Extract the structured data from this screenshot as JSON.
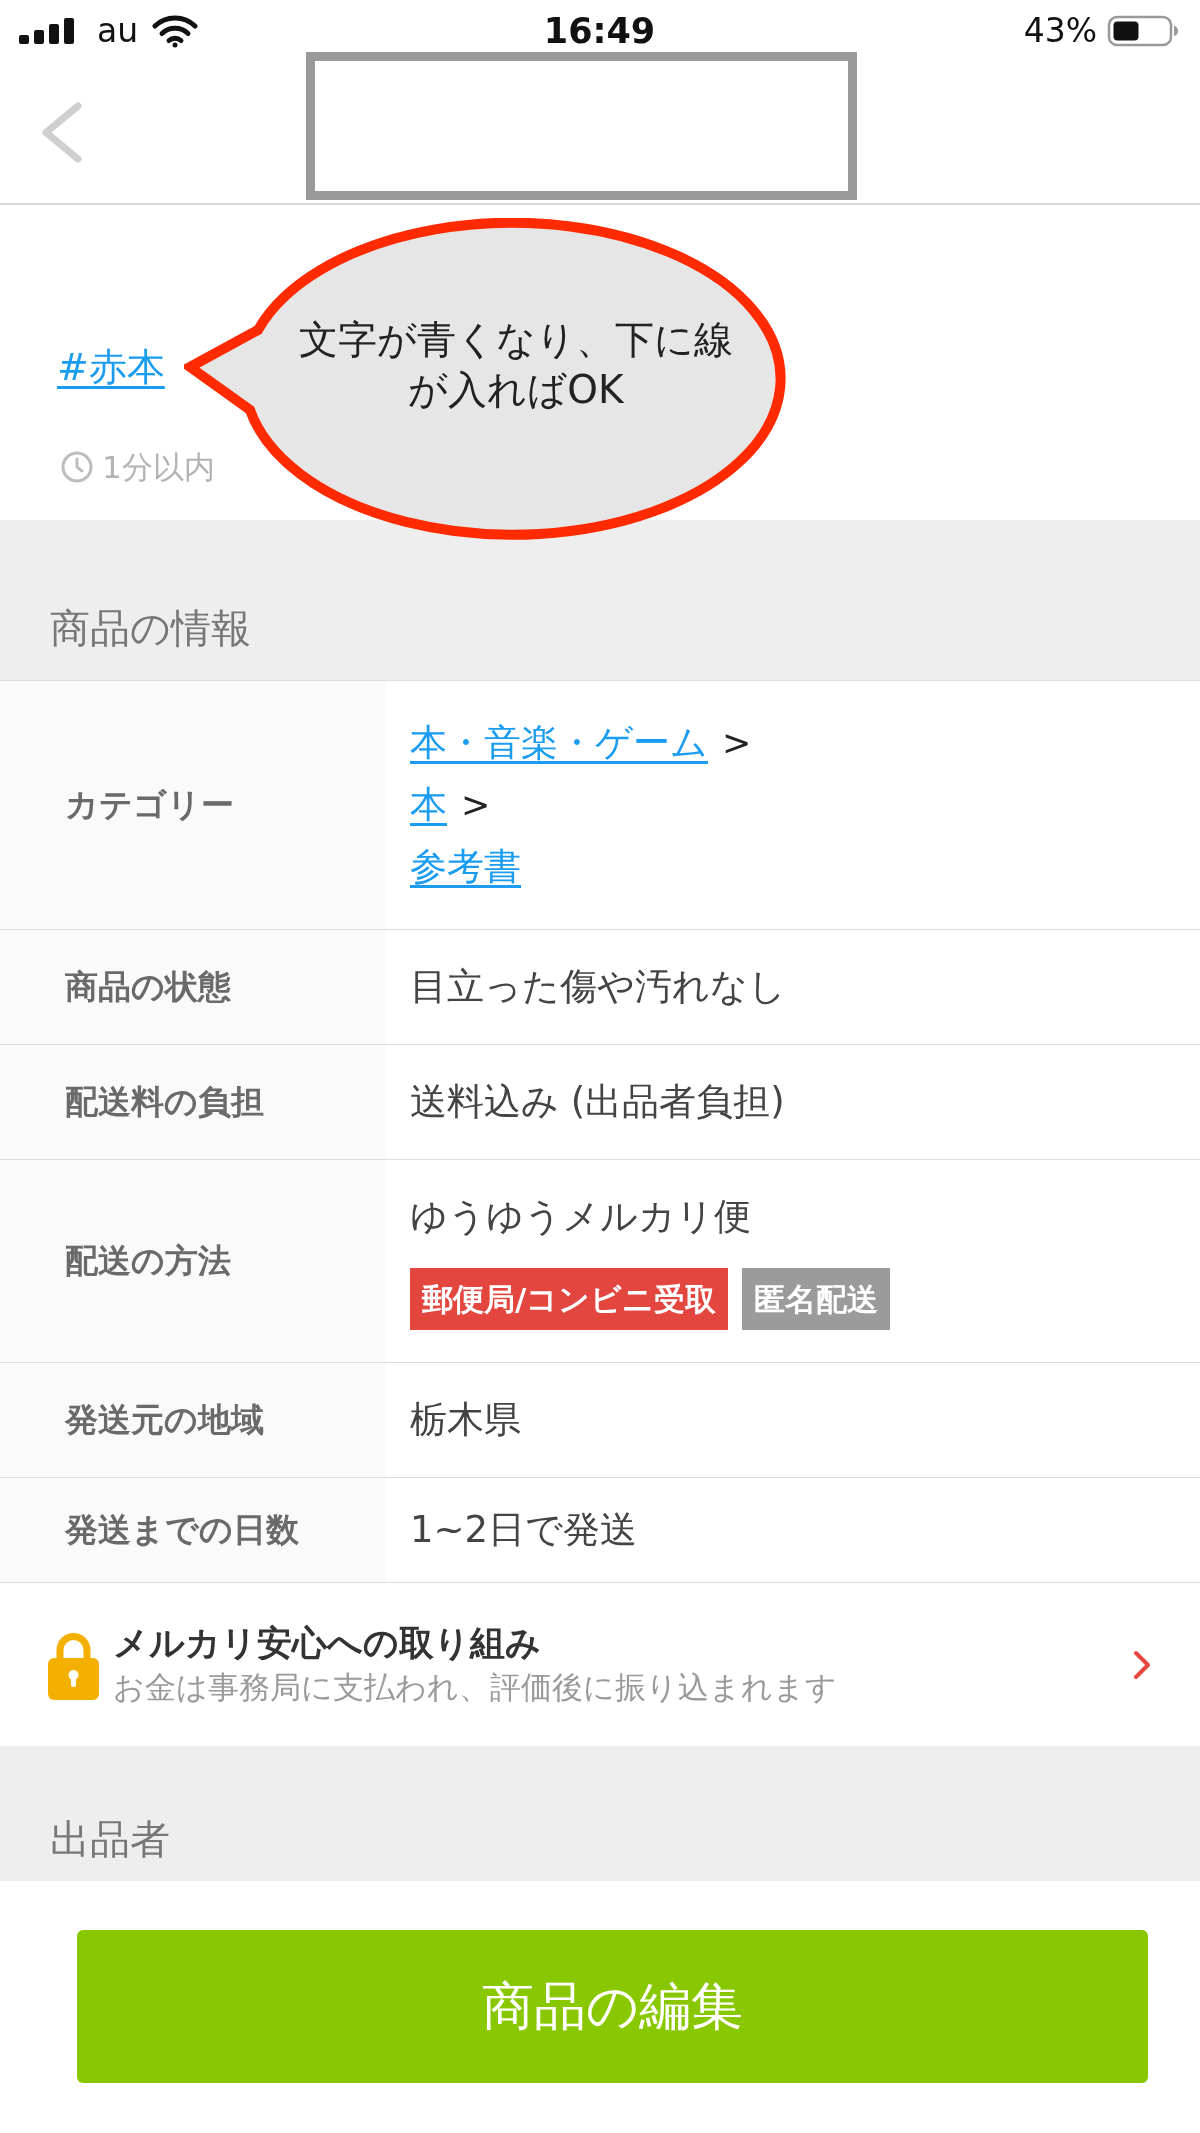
{
  "status_bar": {
    "carrier": "au",
    "time": "16:49",
    "battery": "43%"
  },
  "post": {
    "hashtag": "#赤本",
    "posted": "1分以内"
  },
  "callout": {
    "lines": [
      "文字が青くなり、下に線",
      "が入ればOK"
    ]
  },
  "item_info": {
    "title": "商品の情報",
    "rows": [
      {
        "kind": "links",
        "label": "カテゴリー",
        "links": [
          {
            "text": "本・音楽・ゲーム",
            "separator": ">"
          },
          {
            "text": "本",
            "separator": ">"
          },
          {
            "text": "参考書"
          }
        ]
      },
      {
        "kind": "text",
        "label": "商品の状態",
        "value": "目立った傷や汚れなし"
      },
      {
        "kind": "text",
        "label": "配送料の負担",
        "value": "送料込み (出品者負担)"
      },
      {
        "kind": "badges",
        "label": "配送の方法",
        "value": "ゆうゆうメルカリ便",
        "badges": [
          {
            "text": "郵便局/コンビニ受取",
            "color": "#e2463f"
          },
          {
            "text": "匿名配送",
            "color": "#9b9b9b"
          }
        ]
      },
      {
        "kind": "text",
        "label": "発送元の地域",
        "value": "栃木県"
      },
      {
        "kind": "text",
        "label": "発送までの日数",
        "value": "1~2日で発送"
      }
    ]
  },
  "safety": {
    "title": "メルカリ安心への取り組み",
    "subtitle": "お金は事務局に支払われ、評価後に振り込まれます"
  },
  "seller": {
    "title": "出品者"
  },
  "edit_button": {
    "label": "商品の編集"
  }
}
